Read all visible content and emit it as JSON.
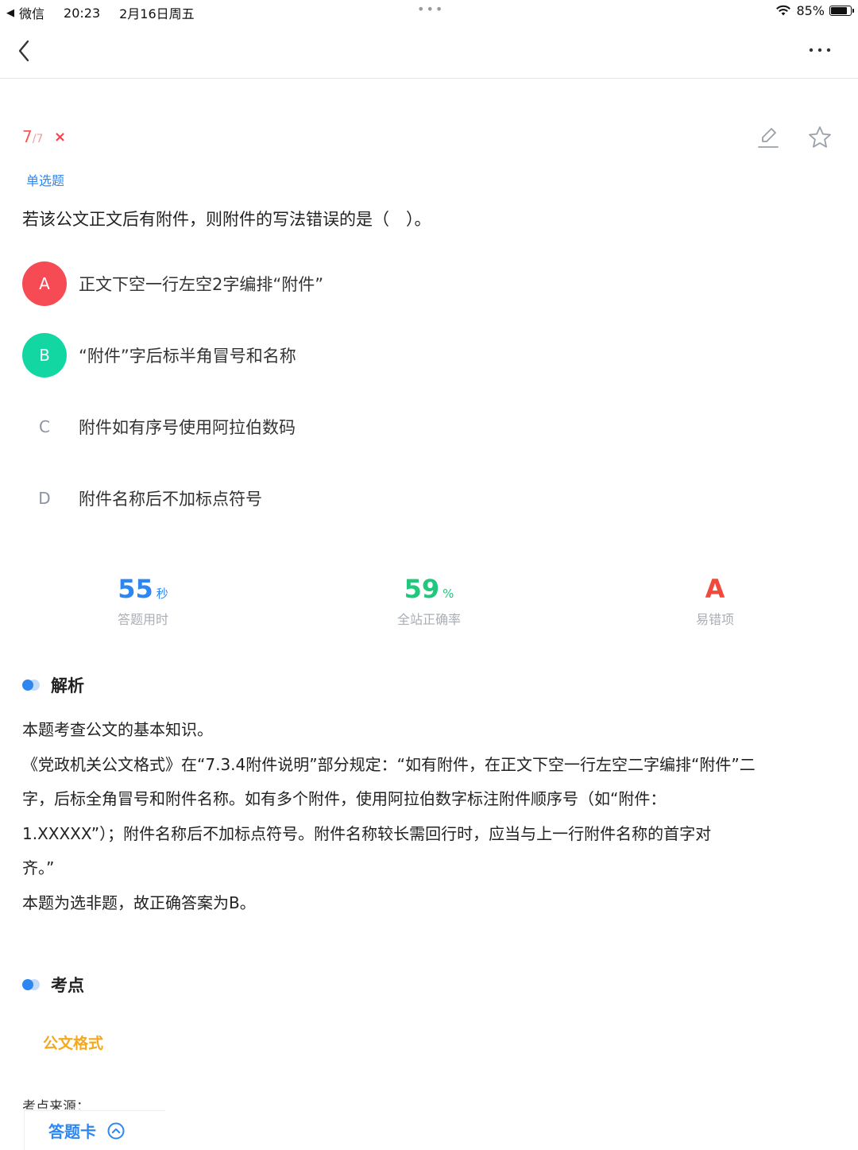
{
  "status_bar": {
    "back_app": "微信",
    "time": "20:23",
    "date": "2月16日周五",
    "center_dots": "•••",
    "battery_percent": "85%",
    "battery_level": 0.85
  },
  "nav": {
    "back_icon": "chevron-left-icon",
    "more_icon": "more-horizontal-icon"
  },
  "question": {
    "progress_current": "7",
    "progress_sep": "/",
    "progress_total": "7",
    "result_mark": "×",
    "type": "单选题",
    "stem": "若该公文正文后有附件，则附件的写法错误的是（　）。",
    "options": [
      {
        "letter": "A",
        "text": "正文下空一行左空2字编排“附件”",
        "state": "wrong"
      },
      {
        "letter": "B",
        "text": "“附件”字后标半角冒号和名称",
        "state": "correct"
      },
      {
        "letter": "C",
        "text": "附件如有序号使用阿拉伯数码",
        "state": "none"
      },
      {
        "letter": "D",
        "text": "附件名称后不加标点符号",
        "state": "none"
      }
    ]
  },
  "stats": {
    "time_value": "55",
    "time_unit": "秒",
    "time_label": "答题用时",
    "accuracy_value": "59",
    "accuracy_unit": "%",
    "accuracy_label": "全站正确率",
    "common_wrong_value": "A",
    "common_wrong_label": "易错项"
  },
  "analysis": {
    "title": "解析",
    "lines": [
      "本题考查公文的基本知识。",
      "《党政机关公文格式》在“7.3.4附件说明”部分规定：“如有附件，在正文下空一行左空二字编排“附件”二",
      "字，后标全角冒号和附件名称。如有多个附件，使用阿拉伯数字标注附件顺序号（如“附件：",
      "1.XXXXX”）；附件名称后不加标点符号。附件名称较长需回行时，应当与上一行附件名称的首字对",
      "齐。”",
      "本题为选非题，故正确答案为B。"
    ]
  },
  "key_points": {
    "title": "考点",
    "tag": "公文格式",
    "source_label": "考点来源："
  },
  "bottom": {
    "answer_card_label": "答题卡"
  },
  "colors": {
    "primary_blue": "#2e86f0",
    "wrong_red": "#f64b54",
    "correct_green": "#13d7a3",
    "tag_orange": "#f4a91c"
  }
}
